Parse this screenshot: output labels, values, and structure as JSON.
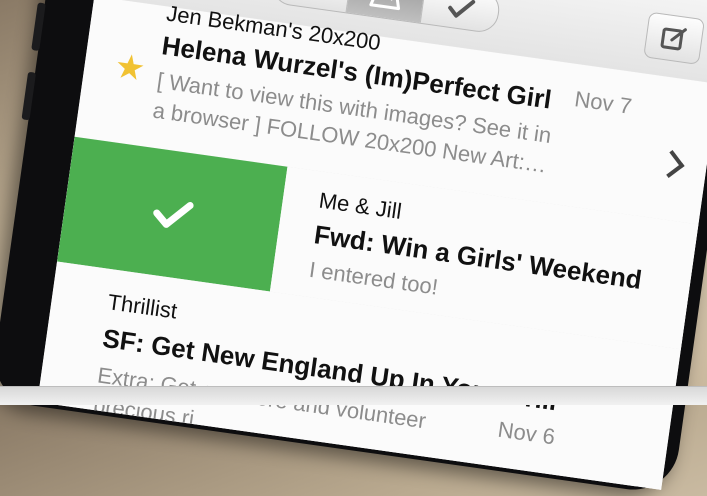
{
  "nav": {
    "icons": {
      "clock": "clock-icon",
      "inbox": "inbox-tray-icon",
      "done": "checkmark-icon",
      "compose": "compose-icon"
    },
    "accent_color": "#9b9b9b"
  },
  "emails": [
    {
      "sender": "Jen Bekman's 20x200",
      "subject": "Helena Wurzel's (Im)Perfect Girl",
      "preview_line1": "[ Want to view this with images? See it in",
      "preview_line2": "a browser ] FOLLOW 20x200 New Art:…",
      "date": "Nov 7",
      "starred": true
    },
    {
      "sender": "Me & Jill",
      "subject": "Fwd: Win a Girls' Weekend",
      "preview_line1": "I entered too!",
      "swipe_action_color": "#4caf50"
    },
    {
      "sender": "Thrillist",
      "subject": "SF: Get New England Up In Your Grill",
      "preview_line1": "Extra: Get out there and volunteer",
      "preview_line2": "precious ri",
      "date": "Nov 6"
    }
  ]
}
